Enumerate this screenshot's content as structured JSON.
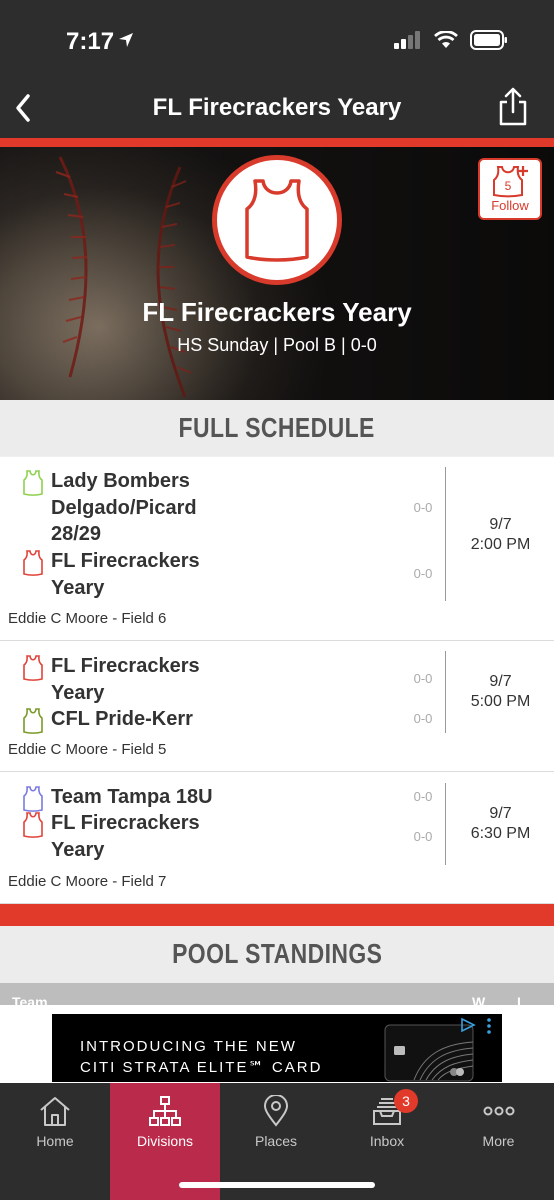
{
  "status_bar": {
    "time": "7:17"
  },
  "navbar": {
    "title": "FL Firecrackers Yeary"
  },
  "hero": {
    "team_name": "FL Firecrackers Yeary",
    "subtitle": "HS Sunday | Pool B | 0-0",
    "follow_label": "Follow",
    "follow_badge": "5"
  },
  "schedule": {
    "header": "FULL SCHEDULE",
    "games": [
      {
        "team1": {
          "name": "Lady Bombers Delgado/Picard 28/29",
          "record": "0-0",
          "jersey_color": "#8fd14f"
        },
        "team2": {
          "name": "FL Firecrackers Yeary",
          "record": "0-0",
          "jersey_color": "#e0443a"
        },
        "date": "9/7",
        "time": "2:00 PM",
        "field": "Eddie C Moore - Field 6"
      },
      {
        "team1": {
          "name": "FL Firecrackers Yeary",
          "record": "0-0",
          "jersey_color": "#e0443a"
        },
        "team2": {
          "name": "CFL Pride-Kerr",
          "record": "0-0",
          "jersey_color": "#7a9a2a"
        },
        "date": "9/7",
        "time": "5:00 PM",
        "field": "Eddie C Moore - Field 5"
      },
      {
        "team1": {
          "name": "Team Tampa 18U",
          "record": "0-0",
          "jersey_color": "#7b7be0"
        },
        "team2": {
          "name": "FL Firecrackers Yeary",
          "record": "0-0",
          "jersey_color": "#e0443a"
        },
        "date": "9/7",
        "time": "6:30 PM",
        "field": "Eddie C Moore - Field 7"
      }
    ]
  },
  "standings": {
    "header": "POOL STANDINGS",
    "columns": [
      "Team",
      "W",
      "L"
    ]
  },
  "ad": {
    "line1": "INTRODUCING THE NEW",
    "line2": "CITI STRATA ELITE℠ CARD"
  },
  "tabbar": {
    "tabs": [
      {
        "label": "Home",
        "icon": "home-icon"
      },
      {
        "label": "Divisions",
        "icon": "hierarchy-icon",
        "active": true
      },
      {
        "label": "Places",
        "icon": "map-pin-icon"
      },
      {
        "label": "Inbox",
        "icon": "inbox-icon",
        "badge": "3"
      },
      {
        "label": "More",
        "icon": "more-dots-icon"
      }
    ]
  },
  "colors": {
    "accent_red": "#e13a2b",
    "active_tab": "#b92a4b",
    "bar_dark": "#2d2d2d"
  }
}
